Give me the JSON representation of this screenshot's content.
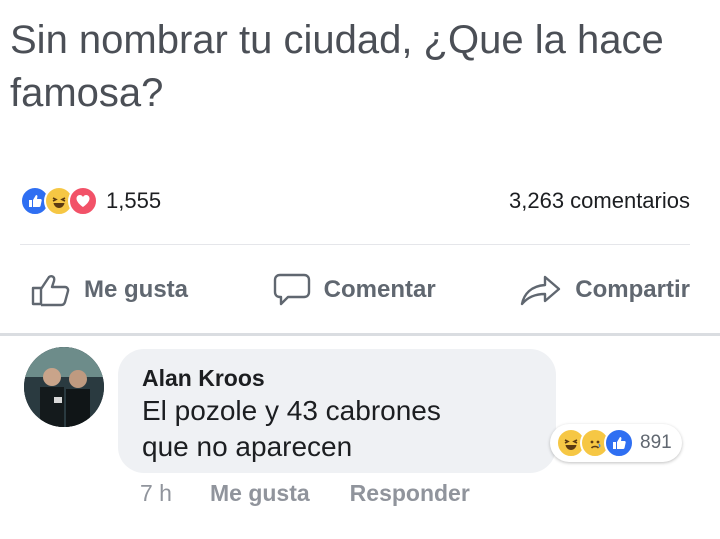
{
  "post": {
    "text": "Sin nombrar tu ciudad, ¿Que la hace famosa?"
  },
  "stats": {
    "reaction_icons": [
      "like-icon",
      "haha-icon",
      "love-icon"
    ],
    "reaction_count": "1,555",
    "comments_count": "3,263 comentarios"
  },
  "actions": {
    "like_label": "Me gusta",
    "comment_label": "Comentar",
    "share_label": "Compartir"
  },
  "comment": {
    "author": "Alan Kroos",
    "text_line1": "El pozole y 43 cabrones",
    "text_line2": "que no aparecen",
    "reaction_icons": [
      "haha-icon",
      "sad-icon",
      "like-icon"
    ],
    "reaction_count": "891",
    "time": "7 h",
    "like_label": "Me gusta",
    "reply_label": "Responder"
  },
  "colors": {
    "like_blue": "#2f6ff2",
    "haha_yellow": "#f6c744",
    "love_red": "#f25268",
    "muted_text": "#606770",
    "bubble_bg": "#eff1f4"
  }
}
